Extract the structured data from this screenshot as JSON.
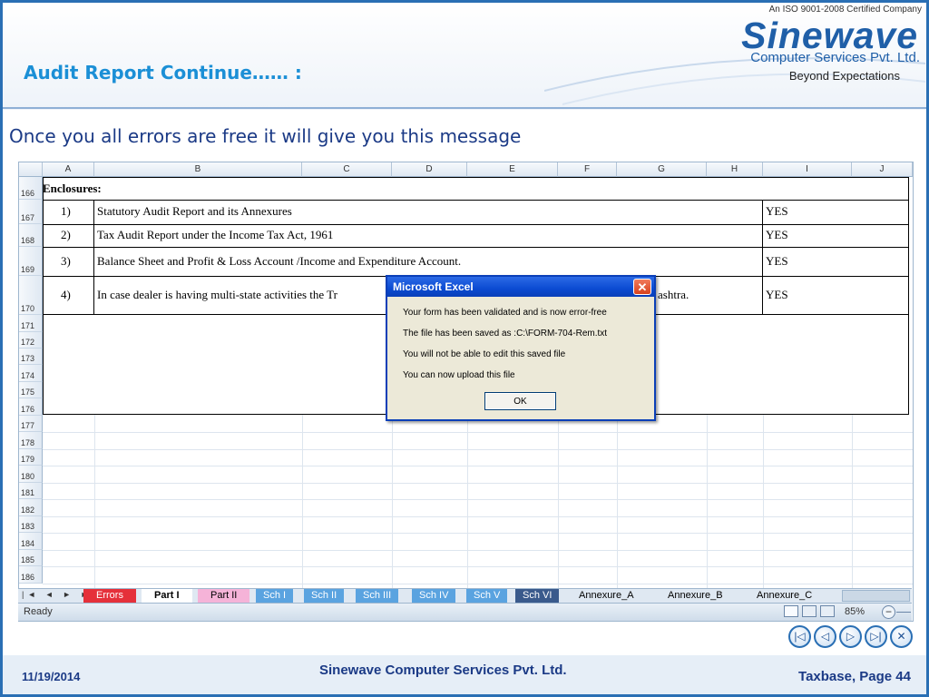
{
  "header": {
    "iso": "An ISO 9001-2008 Certified Company",
    "brand": "Sinewave",
    "brand_sub": "Computer Services Pvt. Ltd.",
    "brand_tag": "Beyond Expectations"
  },
  "slide": {
    "title": "Audit Report Continue…… :",
    "caption": "Once you all errors are free it will give you this message"
  },
  "sheet": {
    "columns": [
      "A",
      "B",
      "C",
      "D",
      "E",
      "F",
      "G",
      "H",
      "I",
      "J"
    ],
    "rows": [
      "166",
      "167",
      "168",
      "169",
      "170",
      "171",
      "172",
      "173",
      "174",
      "175",
      "176",
      "177",
      "178",
      "179",
      "180",
      "181",
      "182",
      "183",
      "184",
      "185",
      "186"
    ],
    "enclosures_label": "Enclosures:",
    "items": [
      {
        "num": "1)",
        "text": "Statutory Audit Report and its Annexures",
        "status": "YES"
      },
      {
        "num": "2)",
        "text": "Tax Audit Report under the Income Tax Act, 1961",
        "status": "YES"
      },
      {
        "num": "3)",
        "text": "Balance Sheet and Profit & Loss Account /Income and Expenditure  Account.",
        "status": "YES"
      },
      {
        "num": "4)",
        "text": "In case dealer is having multi-state activities the Tr",
        "text_tail": "ashtra.",
        "status": "YES"
      }
    ],
    "tabs": [
      "Errors",
      "Part I",
      "Part II",
      "Sch I",
      "Sch II",
      "Sch III",
      "Sch IV",
      "Sch V",
      "Sch VI",
      "Annexure_A",
      "Annexure_B",
      "Annexure_C"
    ],
    "active_tab": "Part I",
    "status": "Ready",
    "zoom": "85%"
  },
  "dialog": {
    "title": "Microsoft Excel",
    "messages": [
      "Your form has been validated and is now error-free",
      "The file has been saved as :C:\\FORM-704-Rem.txt",
      "You will not be able to edit this saved file",
      "You can now upload this file"
    ],
    "ok_label": "OK"
  },
  "nav": {
    "icons": [
      "first-slide-icon",
      "previous-slide-icon",
      "next-slide-icon",
      "last-slide-icon",
      "close-icon"
    ]
  },
  "footer": {
    "date": "11/19/2014",
    "company": "Sinewave Computer Services Pvt. Ltd.",
    "page": "Taxbase, Page 44"
  },
  "colors": {
    "frame": "#2a6fb4",
    "title": "#1b8fd6",
    "caption": "#1b3a86",
    "dialog_title": "#0b4bd2"
  }
}
